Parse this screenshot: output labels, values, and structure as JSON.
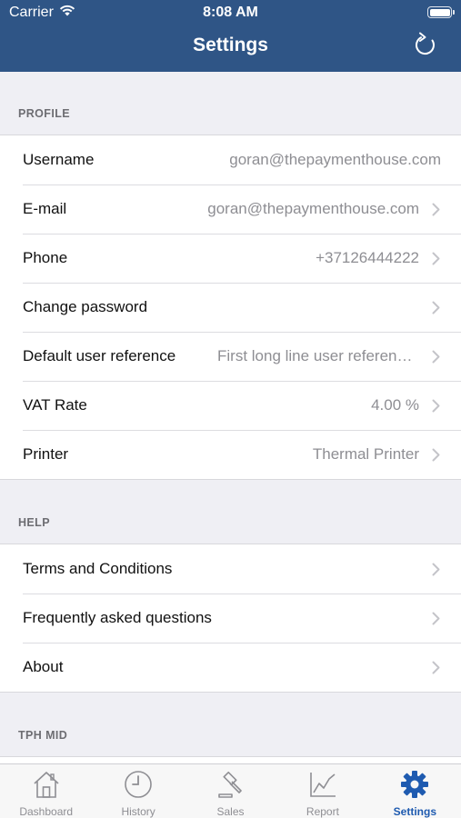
{
  "status_bar": {
    "carrier": "Carrier",
    "time": "8:08 AM"
  },
  "nav": {
    "title": "Settings",
    "refresh_icon": "refresh-icon"
  },
  "colors": {
    "header": "#2f5586",
    "accent": "#1f5bb0",
    "secondary_text": "#8e8e93"
  },
  "sections": {
    "profile": {
      "title": "PROFILE",
      "rows": {
        "username": {
          "label": "Username",
          "value": "goran@thepaymenthouse.com"
        },
        "email": {
          "label": "E-mail",
          "value": "goran@thepaymenthouse.com"
        },
        "phone": {
          "label": "Phone",
          "value": "+37126444222"
        },
        "change_password": {
          "label": "Change password"
        },
        "default_reference": {
          "label": "Default user reference",
          "value": "First long line user reference..."
        },
        "vat_rate": {
          "label": "VAT Rate",
          "value": "4.00 %"
        },
        "printer": {
          "label": "Printer",
          "value": "Thermal Printer"
        }
      }
    },
    "help": {
      "title": "HELP",
      "rows": {
        "terms": {
          "label": "Terms and Conditions"
        },
        "faq": {
          "label": "Frequently asked questions"
        },
        "about": {
          "label": "About"
        }
      }
    },
    "tph_mid": {
      "title": "TPH MID"
    }
  },
  "tab_bar": {
    "dashboard": {
      "label": "Dashboard",
      "icon": "home-icon"
    },
    "history": {
      "label": "History",
      "icon": "clock-icon"
    },
    "sales": {
      "label": "Sales",
      "icon": "gavel-icon"
    },
    "report": {
      "label": "Report",
      "icon": "chart-icon"
    },
    "settings": {
      "label": "Settings",
      "icon": "gear-icon",
      "active": true
    }
  }
}
